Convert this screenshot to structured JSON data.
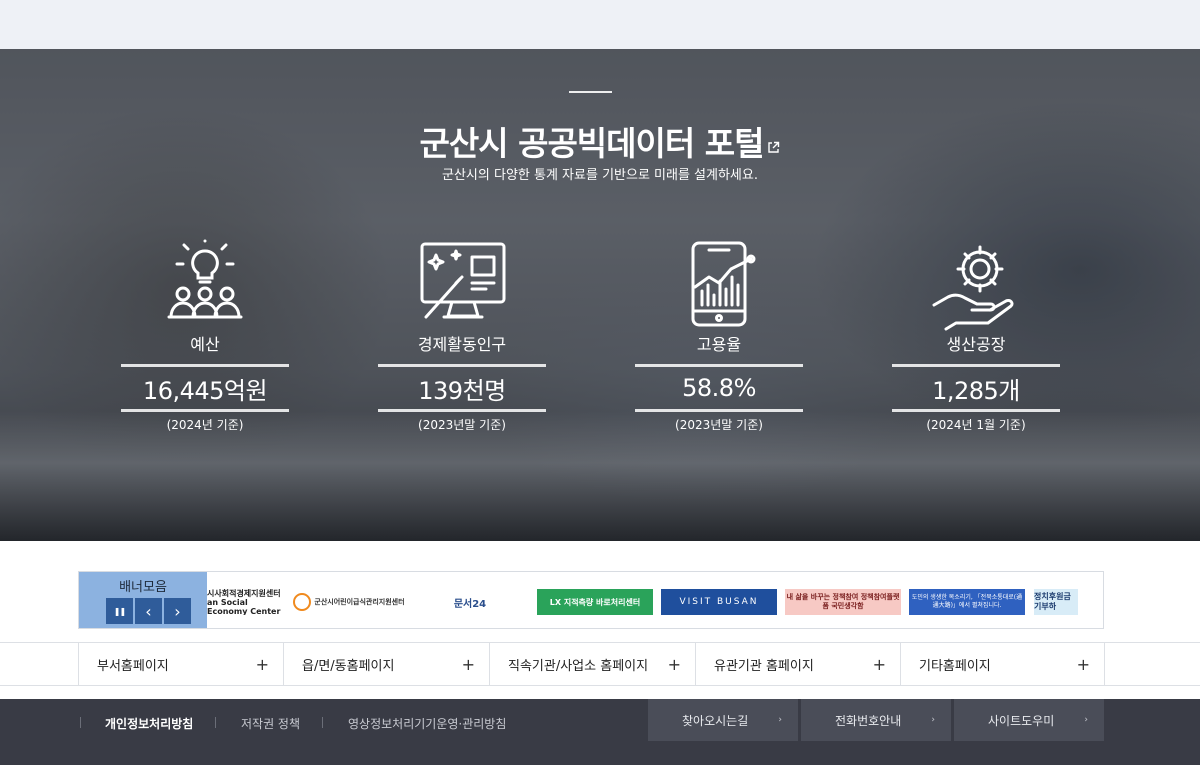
{
  "hero": {
    "title": "군산시 공공빅데이터 포털",
    "subtitle": "군산시의 다양한 통계 자료를 기반으로 미래를 설계하세요."
  },
  "stats": [
    {
      "icon": "people-lightbulb-icon",
      "name": "예산",
      "value": "16,445억원",
      "note": "(2024년 기준)"
    },
    {
      "icon": "monitor-magic-wand-icon",
      "name": "경제활동인구",
      "value": "139천명",
      "note": "(2023년말 기준)"
    },
    {
      "icon": "smartphone-chart-icon",
      "name": "고용율",
      "value": "58.8%",
      "note": "(2023년말 기준)"
    },
    {
      "icon": "hand-gear-icon",
      "name": "생산공장",
      "value": "1,285개",
      "note": "(2024년 1월 기준)"
    }
  ],
  "banner": {
    "label": "배너모음",
    "controls": {
      "pause": "❚❚",
      "prev": "‹",
      "next": "›"
    },
    "items": [
      {
        "text": "시사회적경제지원센터 an Social Economy Center"
      },
      {
        "text": "군산시어린이급식관리지원센터"
      },
      {
        "text": "문서24"
      },
      {
        "text": "LX 지적측량 바로처리센터"
      },
      {
        "text": "VISIT BUSAN"
      },
      {
        "text": "내 삶을 바꾸는 정책참여 정책참여플랫폼 국민생각함"
      },
      {
        "text": "도민의 생생한 목소리기, 「전북소통대로(通通大路)」에서 펼쳐집니다."
      },
      {
        "text": "정치후원금 기부하"
      }
    ]
  },
  "link_row": [
    {
      "label": "부서홈페이지",
      "plus": "+"
    },
    {
      "label": "읍/면/동홈페이지",
      "plus": "+"
    },
    {
      "label": "직속기관/사업소 홈페이지",
      "plus": "+"
    },
    {
      "label": "유관기관 홈페이지",
      "plus": "+"
    },
    {
      "label": "기타홈페이지",
      "plus": "+"
    }
  ],
  "footer": {
    "links": [
      "개인정보처리방침",
      "저작권 정책",
      "영상정보처리기기운영·관리방침"
    ],
    "buttons": [
      {
        "label": "찾아오시는길",
        "chevron": "›"
      },
      {
        "label": "전화번호안내",
        "chevron": "›"
      },
      {
        "label": "사이트도우미",
        "chevron": "›"
      }
    ]
  }
}
